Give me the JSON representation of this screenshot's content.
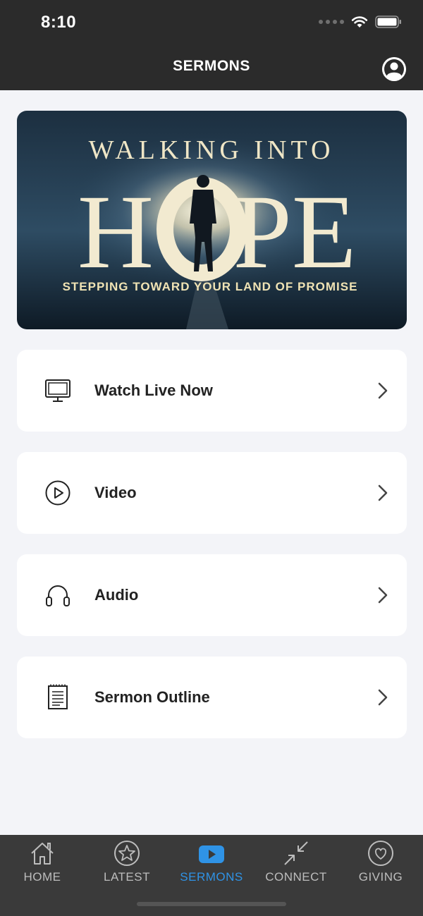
{
  "status_bar": {
    "time": "8:10"
  },
  "header": {
    "title": "SERMONS"
  },
  "banner": {
    "title_top": "WALKING INTO",
    "title_main_left": "H",
    "title_main_right": "PE",
    "subtitle": "STEPPING TOWARD YOUR LAND OF PROMISE"
  },
  "menu": [
    {
      "label": "Watch Live Now",
      "icon": "monitor-icon"
    },
    {
      "label": "Video",
      "icon": "play-circle-icon"
    },
    {
      "label": "Audio",
      "icon": "headphones-icon"
    },
    {
      "label": "Sermon Outline",
      "icon": "notepad-icon"
    }
  ],
  "tabs": [
    {
      "label": "HOME",
      "icon": "home-icon",
      "active": false
    },
    {
      "label": "LATEST",
      "icon": "star-circle-icon",
      "active": false
    },
    {
      "label": "SERMONS",
      "icon": "youtube-play-icon",
      "active": true
    },
    {
      "label": "CONNECT",
      "icon": "arrows-in-icon",
      "active": false
    },
    {
      "label": "GIVING",
      "icon": "heart-circle-icon",
      "active": false
    }
  ],
  "colors": {
    "accent": "#2f93e6",
    "header_bg": "#2b2b2b",
    "tabbar_bg": "#3a3a3a",
    "page_bg": "#f3f4f8"
  }
}
